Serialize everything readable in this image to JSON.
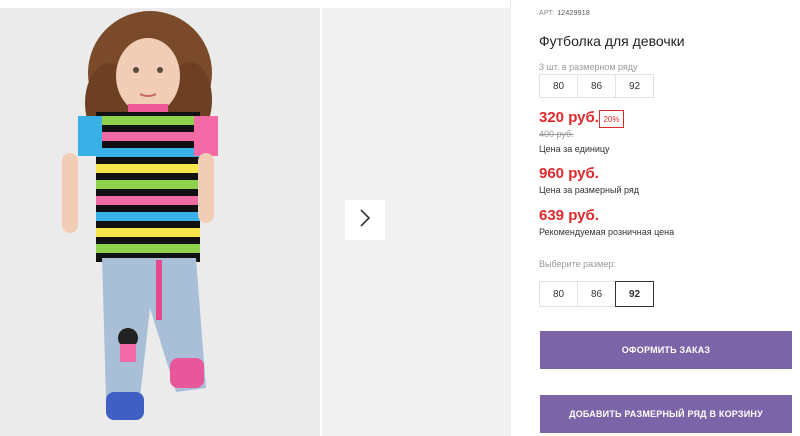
{
  "product": {
    "art_prefix": "АРТ:",
    "art_number": "12429918",
    "title": "Футболка для девочки",
    "range_label": "3 шт. в размерном ряду",
    "range_sizes": [
      "80",
      "86",
      "92"
    ],
    "price_unit": "320 руб.",
    "discount": "20%",
    "old_price": "400 руб.",
    "price_unit_caption": "Цена за единицу",
    "price_range": "960 руб.",
    "price_range_caption": "Цена за размерный ряд",
    "price_rrp": "639 руб.",
    "price_rrp_caption": "Рекомендуемая розничная цена",
    "choose_label": "Выберите размер:",
    "choose_sizes": [
      "80",
      "86",
      "92"
    ],
    "selected_size": "92"
  },
  "buttons": {
    "order": "ОФОРМИТЬ ЗАКАЗ",
    "add_to_cart": "ДОБАВИТЬ РАЗМЕРНЫЙ РЯД В КОРЗИНУ"
  },
  "gallery": {
    "next_icon": "chevron-right-icon"
  },
  "colors": {
    "price": "#e0292b",
    "button": "#7b65a8"
  }
}
